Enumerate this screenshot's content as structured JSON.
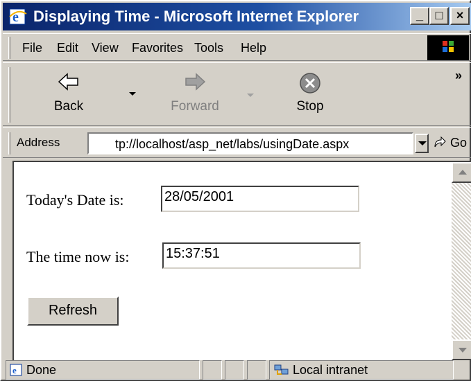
{
  "window": {
    "title": "Displaying Time - Microsoft Internet Explorer",
    "controls": {
      "minimize": "_",
      "maximize": "□",
      "close": "×"
    }
  },
  "menu": [
    "File",
    "Edit",
    "View",
    "Favorites",
    "Tools",
    "Help"
  ],
  "toolbar": {
    "back_label": "Back",
    "forward_label": "Forward",
    "stop_label": "Stop",
    "more_label": "»"
  },
  "address": {
    "label": "Address",
    "url": "tp://localhost/asp_net/labs/usingDate.aspx",
    "go_label": "Go"
  },
  "page": {
    "date_label": "Today's Date is:",
    "date_value": "28/05/2001",
    "time_label": "The time now is:",
    "time_value": "15:37:51",
    "refresh_label": "Refresh"
  },
  "status": {
    "text": "Done",
    "zone": "Local intranet"
  },
  "colors": {
    "titlebar_start": "#0a246a",
    "titlebar_end": "#a6caf0",
    "chrome": "#d4d0c8"
  },
  "icons": {
    "title": "ie-logo-icon",
    "back": "back-arrow-icon",
    "forward": "forward-arrow-icon",
    "stop": "stop-icon",
    "go": "go-arrow-icon",
    "status": "page-done-icon",
    "zone": "local-intranet-icon"
  }
}
